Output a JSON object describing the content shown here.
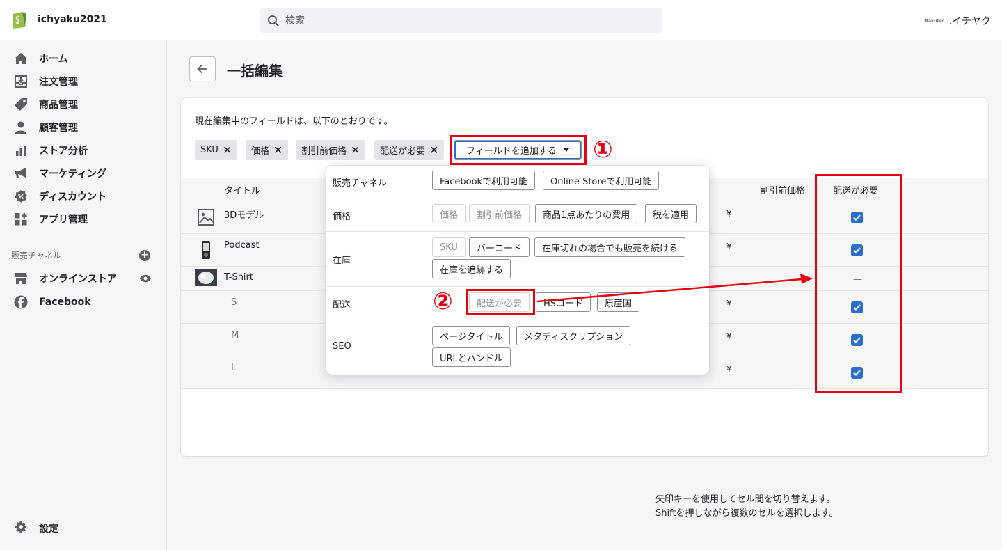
{
  "topbar": {
    "store_name": "ichyaku2021",
    "search_placeholder": "検索",
    "rakuten_logo": "Rakuten",
    "account_name": ".イチヤク"
  },
  "sidebar": {
    "items": [
      {
        "label": "ホーム",
        "icon": "home-icon"
      },
      {
        "label": "注文管理",
        "icon": "orders-icon"
      },
      {
        "label": "商品管理",
        "icon": "tag-icon"
      },
      {
        "label": "顧客管理",
        "icon": "customer-icon"
      },
      {
        "label": "ストア分析",
        "icon": "analytics-icon"
      },
      {
        "label": "マーケティング",
        "icon": "megaphone-icon"
      },
      {
        "label": "ディスカウント",
        "icon": "discount-icon"
      },
      {
        "label": "アプリ管理",
        "icon": "apps-icon"
      }
    ],
    "sales_channel_title": "販売チャネル",
    "channels": [
      {
        "label": "オンラインストア",
        "icon": "store-icon"
      },
      {
        "label": "Facebook",
        "icon": "facebook-icon"
      }
    ],
    "settings_label": "設定"
  },
  "page": {
    "title": "一括編集",
    "intro": "現在編集中のフィールドは、以下のとおりです。",
    "chips": [
      "SKU",
      "価格",
      "割引前価格",
      "配送が必要"
    ],
    "add_field_label": "フィールドを追加する"
  },
  "table": {
    "headers": {
      "title": "タイトル",
      "compare_price": "割引前価格",
      "requires_shipping": "配送が必要"
    },
    "rows": [
      {
        "title": "3Dモデル",
        "yen": "¥",
        "shipping": true
      },
      {
        "title": "Podcast",
        "yen": "¥",
        "shipping": true
      },
      {
        "title": "T-Shirt",
        "yen": "",
        "shipping": null,
        "dash": "—"
      },
      {
        "title": "S",
        "yen": "¥",
        "shipping": true
      },
      {
        "title": "M",
        "yen": "¥",
        "shipping": true
      },
      {
        "title": "L",
        "yen": "¥",
        "shipping": true
      }
    ]
  },
  "dropdown": {
    "sections": [
      {
        "label": "販売チャネル",
        "options": [
          "Facebookで利用可能",
          "Online Storeで利用可能"
        ]
      },
      {
        "label": "価格",
        "options": [
          "価格",
          "割引前価格",
          "商品1点あたりの費用",
          "税を適用"
        ]
      },
      {
        "label": "在庫",
        "options": [
          "SKU",
          "バーコード",
          "在庫切れの場合でも販売を続ける",
          "在庫を追跡する"
        ]
      },
      {
        "label": "配送",
        "options": [
          "配送が必要",
          "HSコード",
          "原産国"
        ]
      },
      {
        "label": "SEO",
        "options": [
          "ページタイトル",
          "メタディスクリプション",
          "URLとハンドル"
        ]
      }
    ]
  },
  "hints": {
    "line1": "矢印キーを使用してセル間を切り替えます。",
    "line2": "Shiftを押しながら複数のセルを選択します。"
  },
  "annotations": {
    "step1": "①",
    "step2": "②",
    "color": "#e50012"
  }
}
